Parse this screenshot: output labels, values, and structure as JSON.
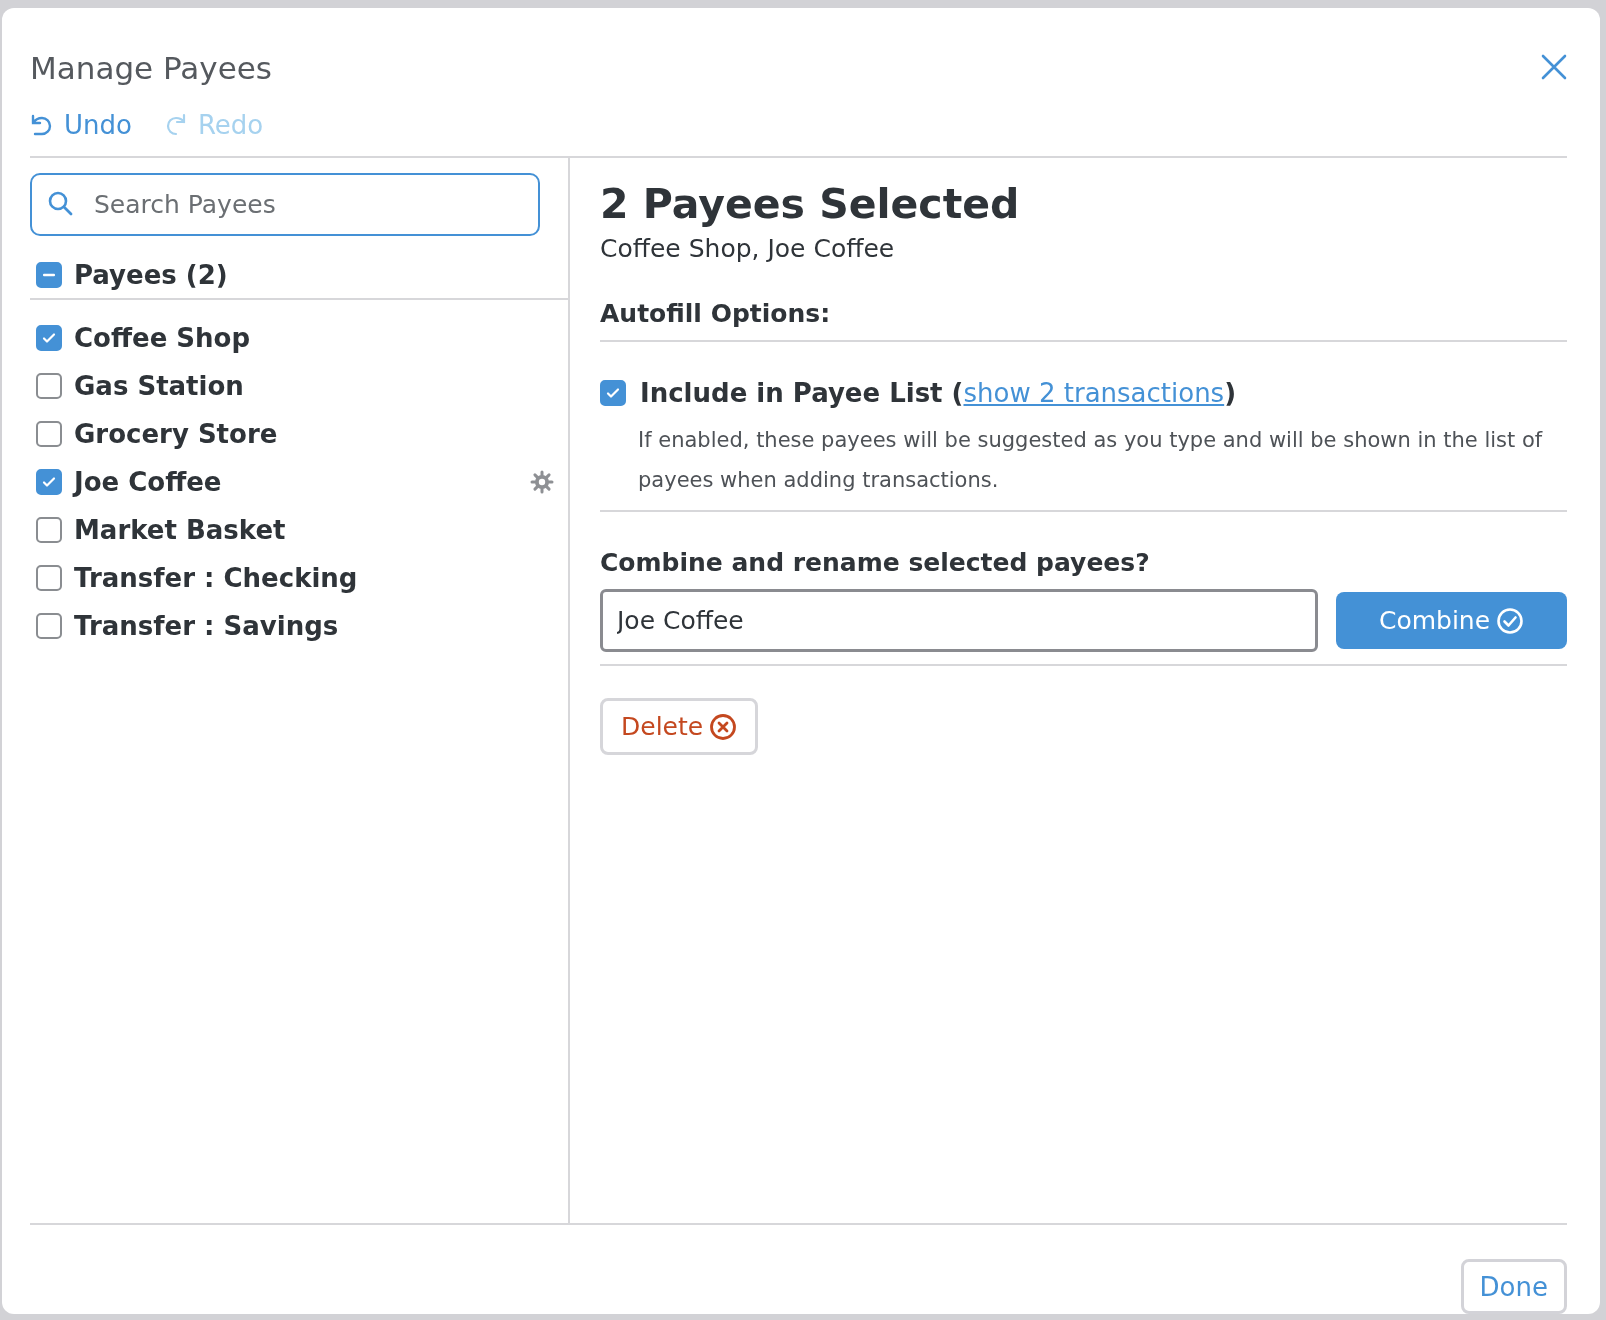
{
  "dialog": {
    "title": "Manage Payees"
  },
  "history": [
    {
      "kind": "undo",
      "label": "Undo",
      "disabled": false
    },
    {
      "kind": "redo",
      "label": "Redo",
      "disabled": true
    }
  ],
  "search": {
    "placeholder": "Search Payees"
  },
  "payee_header": {
    "label": "Payees (2)",
    "mixed": true
  },
  "payees": [
    {
      "name": "Coffee Shop",
      "checked": true,
      "settings": false
    },
    {
      "name": "Gas Station",
      "checked": false,
      "settings": false
    },
    {
      "name": "Grocery Store",
      "checked": false,
      "settings": false
    },
    {
      "name": "Joe Coffee",
      "checked": true,
      "settings": true
    },
    {
      "name": "Market Basket",
      "checked": false,
      "settings": false
    },
    {
      "name": "Transfer : Checking",
      "checked": false,
      "settings": false
    },
    {
      "name": "Transfer : Savings",
      "checked": false,
      "settings": false
    }
  ],
  "detail": {
    "title": "2 Payees Selected",
    "subtitle": "Coffee Shop, Joe Coffee",
    "autofill_heading": "Autofill Options:",
    "include": {
      "checked": true,
      "label_before": "Include in Payee List (",
      "link": "show 2 transactions",
      "label_after": ")",
      "description": "If enabled, these payees will be suggested as you type and will be shown in the list of payees when adding transactions."
    },
    "combine_heading": "Combine and rename selected payees?",
    "combine_value": "Joe Coffee",
    "combine_button": "Combine",
    "delete_button": "Delete"
  },
  "footer": {
    "done_button": "Done"
  }
}
